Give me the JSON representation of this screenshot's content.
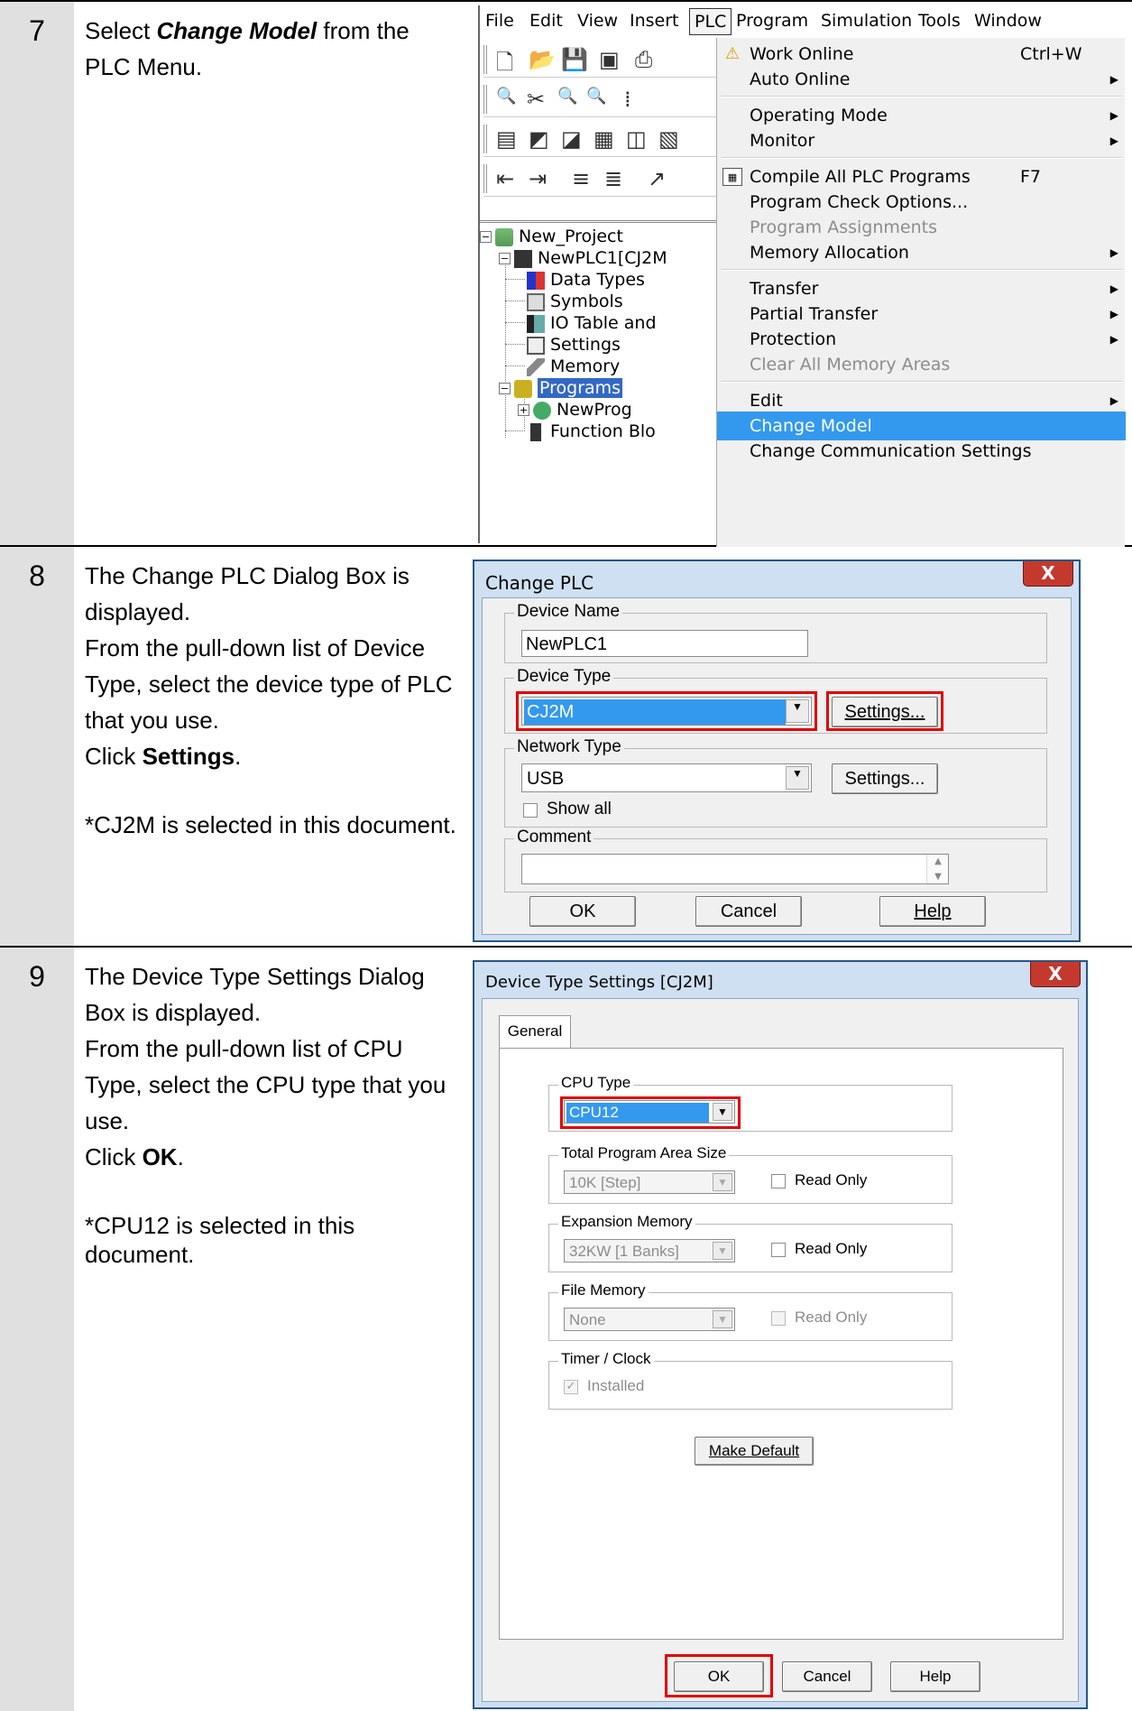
{
  "steps": [
    {
      "number": "7",
      "pre": "Select ",
      "em": "Change Model",
      "post": " from the PLC Menu."
    },
    {
      "number": "8",
      "lines": [
        "The Change PLC Dialog Box is displayed.",
        "From the pull-down list of Device Type, select the device type of PLC that you use."
      ],
      "click_pre": "Click ",
      "click_bold": "Settings",
      "click_post": ".",
      "note": "*CJ2M is selected in this document."
    },
    {
      "number": "9",
      "lines": [
        "The Device Type Settings Dialog Box is displayed.",
        "From the pull-down list of CPU Type, select the CPU type that you use."
      ],
      "click_pre": "Click ",
      "click_bold": "OK",
      "click_post": ".",
      "note": "*CPU12 is selected in this document."
    }
  ],
  "menubar": [
    "File",
    "Edit",
    "View",
    "Insert",
    "PLC",
    "Program",
    "Simulation",
    "Tools",
    "Window"
  ],
  "plc_menu": {
    "work_online": "Work Online",
    "work_online_shortcut": "Ctrl+W",
    "auto_online": "Auto Online",
    "operating_mode": "Operating Mode",
    "monitor": "Monitor",
    "compile_all": "Compile All PLC Programs",
    "compile_shortcut": "F7",
    "program_check": "Program Check Options...",
    "program_assignments": "Program Assignments",
    "memory_allocation": "Memory Allocation",
    "transfer": "Transfer",
    "partial_transfer": "Partial Transfer",
    "protection": "Protection",
    "clear_all": "Clear All Memory Areas",
    "edit": "Edit",
    "change_model": "Change Model",
    "change_comm": "Change Communication Settings"
  },
  "tree": {
    "project": "New_Project",
    "plc": "NewPLC1[CJ2M",
    "data_types": "Data Types",
    "symbols": "Symbols",
    "io_table": "IO Table and",
    "settings": "Settings",
    "memory": "Memory",
    "programs": "Programs",
    "newprog": "NewProg",
    "function_blocks": "Function Blo"
  },
  "change_plc": {
    "title": "Change PLC",
    "close": "X",
    "device_name_label": "Device Name",
    "device_name_value": "NewPLC1",
    "device_type_label": "Device Type",
    "device_type_value": "CJ2M",
    "settings_btn": "Settings...",
    "network_type_label": "Network Type",
    "network_type_value": "USB",
    "settings_btn2": "Settings...",
    "show_all": "Show all",
    "comment_label": "Comment",
    "ok": "OK",
    "cancel": "Cancel",
    "help": "Help"
  },
  "device_type_settings": {
    "title": "Device Type Settings [CJ2M]",
    "close": "X",
    "tab": "General",
    "cpu_type_label": "CPU Type",
    "cpu_type_value": "CPU12",
    "total_area_label": "Total Program Area Size",
    "total_area_value": "10K [Step]",
    "read_only": "Read Only",
    "expansion_label": "Expansion Memory",
    "expansion_value": "32KW [1 Banks]",
    "file_memory_label": "File Memory",
    "file_memory_value": "None",
    "timer_label": "Timer / Clock",
    "installed": "Installed",
    "make_default": "Make Default",
    "ok": "OK",
    "cancel": "Cancel",
    "help": "Help"
  }
}
